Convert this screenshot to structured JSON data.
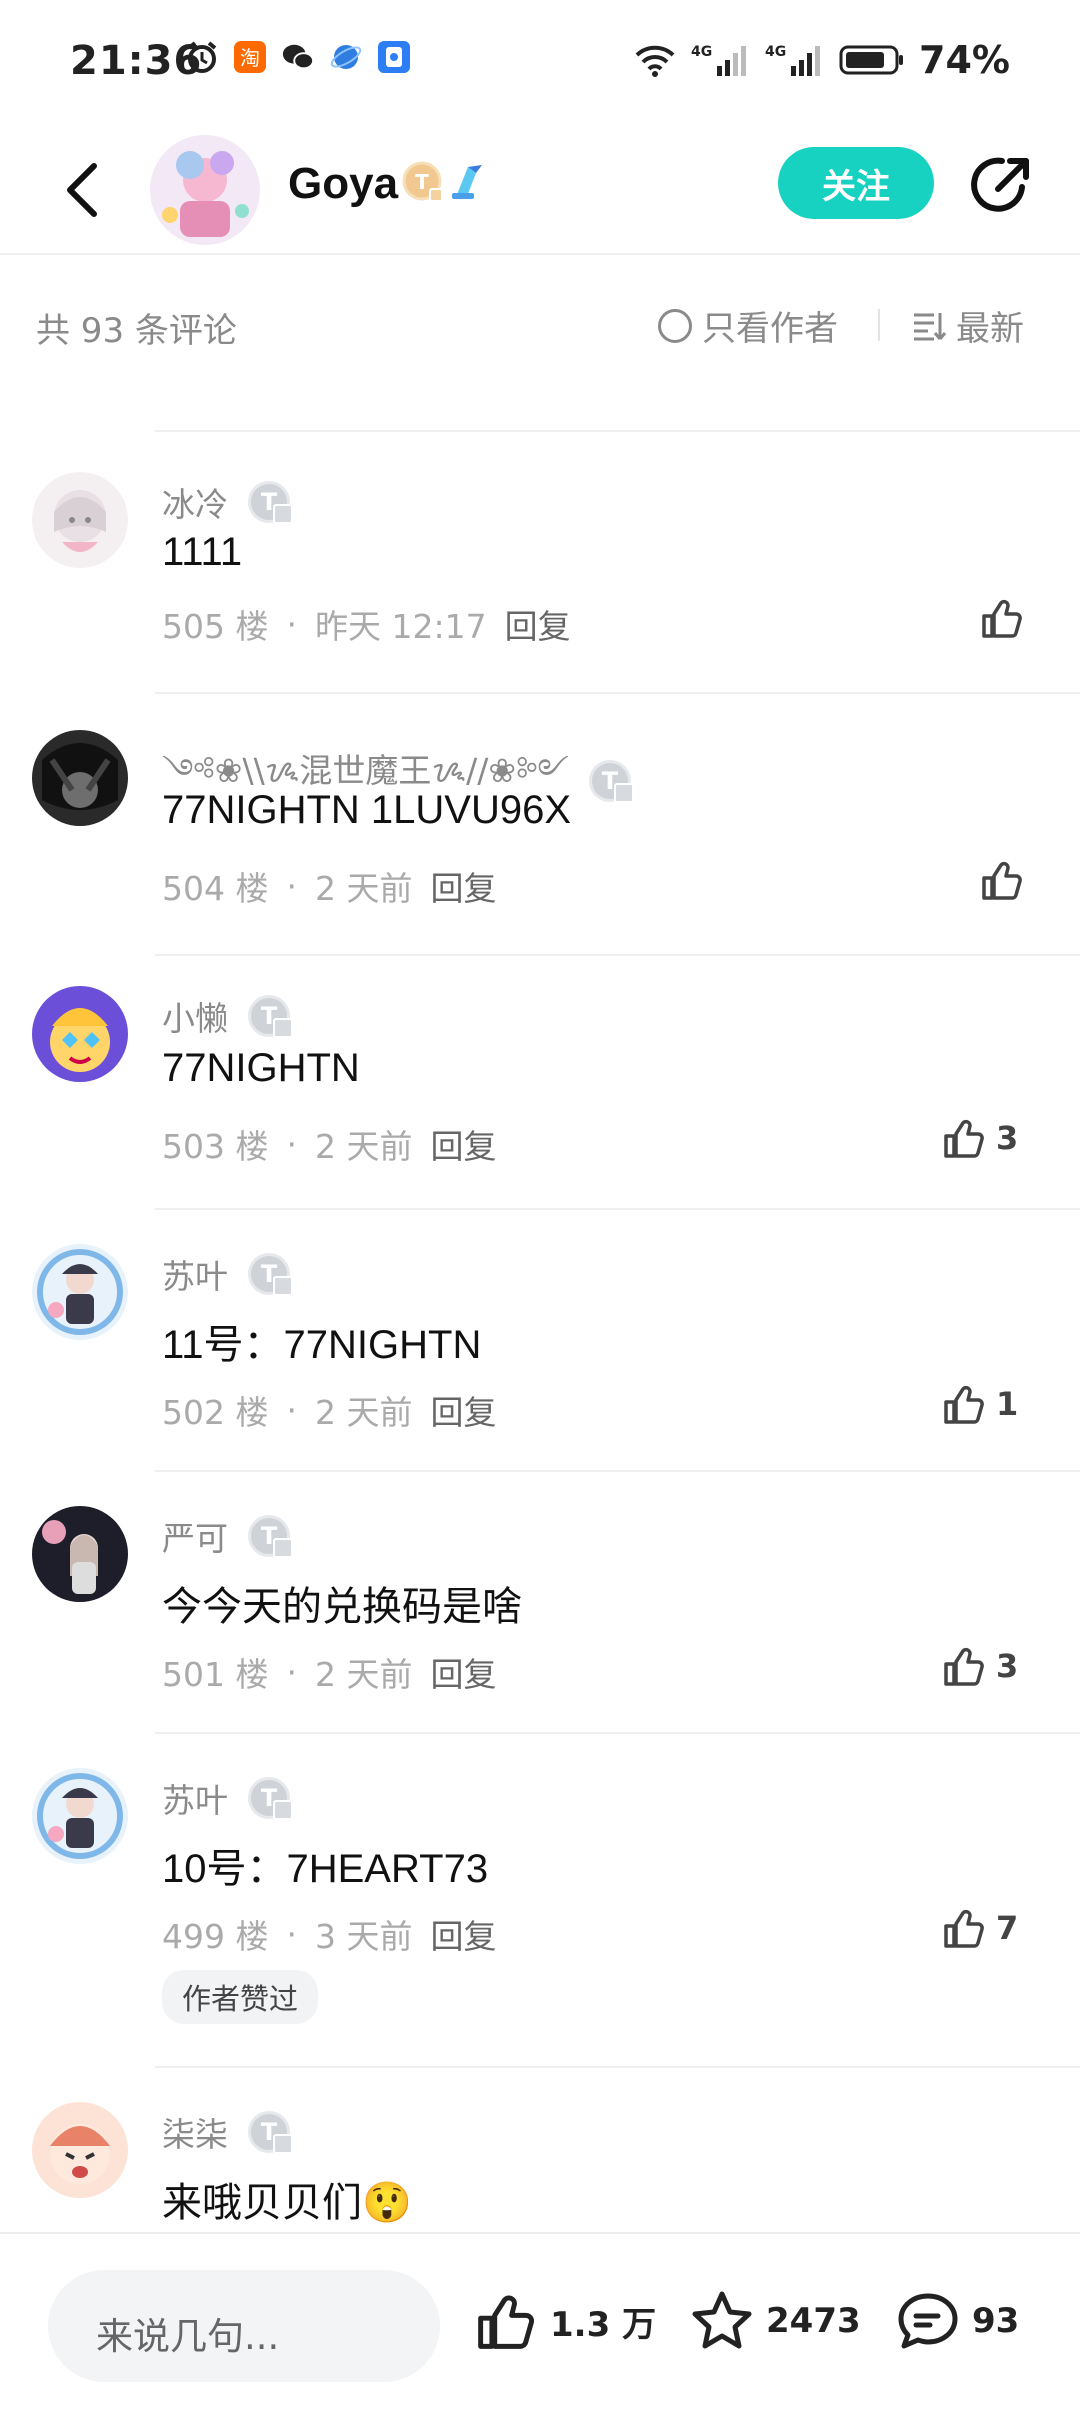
{
  "status_bar": {
    "time": "21:36",
    "battery": "74%",
    "network_1": "4G",
    "network_2": "4G",
    "icons": [
      "alarm-icon",
      "taobao-icon",
      "wechat-icon",
      "browser-icon",
      "app-icon",
      "wifi-icon",
      "signal-icon",
      "battery-icon"
    ]
  },
  "header": {
    "author_name": "Goya",
    "follow_label": "关注",
    "back_icon": "chevron-left-icon",
    "share_icon": "share-icon"
  },
  "sort_bar": {
    "total": "共 93 条评论",
    "author_only": "只看作者",
    "sort_label": "最新"
  },
  "badge_letter": "T",
  "comments": [
    {
      "user": "冰冷",
      "text": "1111",
      "floor": "505 楼",
      "time": "昨天 12:17",
      "reply": "回复",
      "likes": ""
    },
    {
      "user": "༺❀\\\\ᝰ混世魔王ᝰ//❀༻",
      "text": "77NIGHTN  1LUVU96X",
      "floor": "504 楼",
      "time": "2 天前",
      "reply": "回复",
      "likes": ""
    },
    {
      "user": "小懒",
      "text": "77NIGHTN",
      "floor": "503 楼",
      "time": "2 天前",
      "reply": "回复",
      "likes": "3"
    },
    {
      "user": "苏叶",
      "text": "11号：77NIGHTN",
      "floor": "502 楼",
      "time": "2 天前",
      "reply": "回复",
      "likes": "1"
    },
    {
      "user": "严可",
      "text": "今今天的兑换码是啥",
      "floor": "501 楼",
      "time": "2 天前",
      "reply": "回复",
      "likes": "3"
    },
    {
      "user": "苏叶",
      "text": "10号：7HEART73",
      "floor": "499 楼",
      "time": "3 天前",
      "reply": "回复",
      "likes": "7",
      "tag": "作者赞过"
    },
    {
      "user": "柒柒",
      "text": "来哦贝贝们😲",
      "floor": "",
      "time": "",
      "reply": "",
      "likes": ""
    }
  ],
  "bottom_bar": {
    "input_placeholder": "来说几句...",
    "likes": "1.3 万",
    "favorites": "2473",
    "comments": "93"
  },
  "colors": {
    "accent": "#18d2c1",
    "muted_text": "#8a8a8a",
    "badge": "#cfd3d8"
  }
}
